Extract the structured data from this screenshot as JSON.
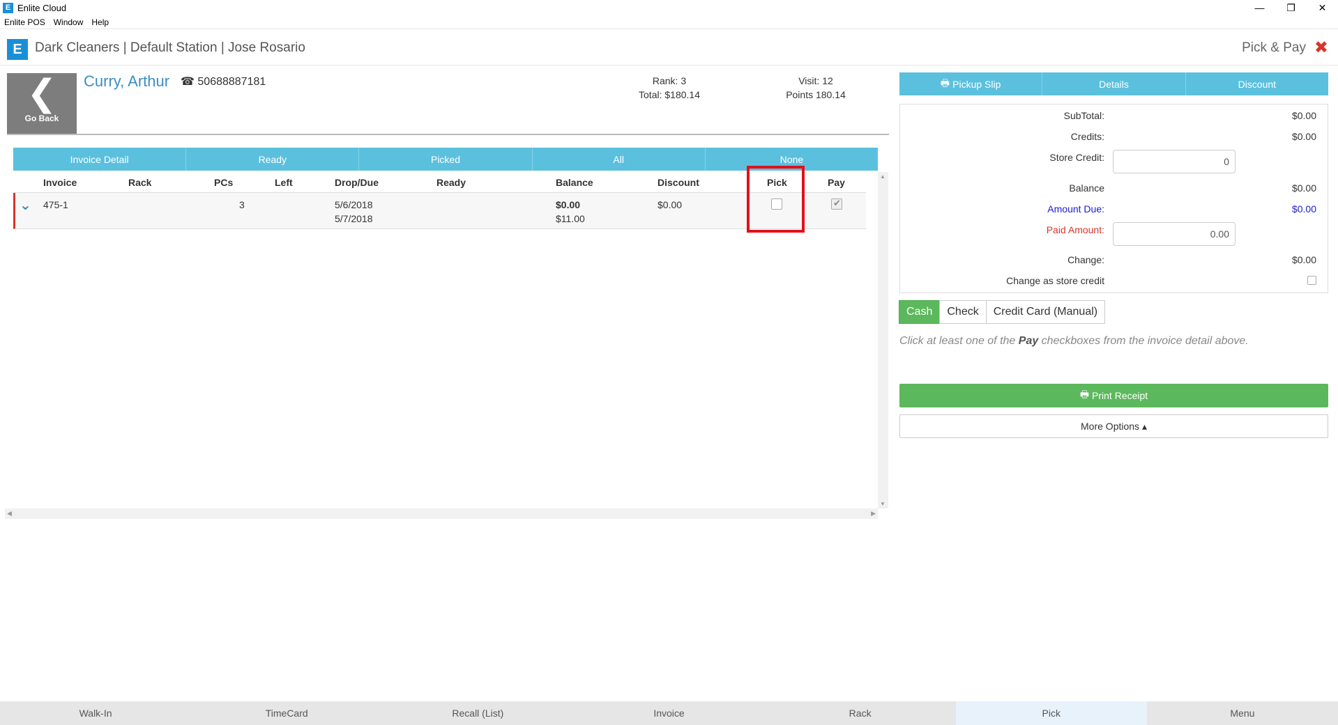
{
  "window": {
    "title": "Enlite Cloud",
    "app_icon": "E",
    "minimize": "—",
    "restore": "❐",
    "close": "✕"
  },
  "menu": [
    "Enlite POS",
    "Window",
    "Help"
  ],
  "header": {
    "logo": "E",
    "title": "Dark Cleaners | Default Station | Jose Rosario",
    "mode": "Pick & Pay",
    "close": "✖"
  },
  "customer": {
    "go_back_icon": "❮",
    "go_back": "Go Back",
    "name": "Curry, Arthur",
    "phone_icon": "☎",
    "phone": "50688887181",
    "rank": "Rank: 3",
    "total": "Total: $180.14",
    "visit": "Visit: 12",
    "points": "Points 180.14"
  },
  "filters": [
    "Invoice Detail",
    "Ready",
    "Picked",
    "All",
    "None"
  ],
  "table": {
    "columns": [
      "Invoice",
      "Rack",
      "PCs",
      "Left",
      "Drop/Due",
      "Ready",
      "Balance",
      "Discount",
      "Pick",
      "Pay"
    ],
    "rows": [
      {
        "expand_icon": "⌄",
        "invoice": "475-1",
        "rack": "",
        "pcs": "3",
        "left": "",
        "drop": "5/6/2018",
        "due": "5/7/2018",
        "ready": "",
        "balance": "$0.00",
        "balance_total": "$11.00",
        "discount": "$0.00",
        "pick": false,
        "pay": true
      }
    ]
  },
  "right_tabs": [
    "Pickup Slip",
    "Details",
    "Discount"
  ],
  "right_tab_icons": {
    "pickup_slip": "🖶"
  },
  "summary": {
    "subtotal_label": "SubTotal:",
    "subtotal": "$0.00",
    "credits_label": "Credits:",
    "credits": "$0.00",
    "store_credit_label": "Store Credit:",
    "store_credit": "0",
    "balance_label": "Balance",
    "balance": "$0.00",
    "amount_due_label": "Amount Due:",
    "amount_due": "$0.00",
    "paid_amount_label": "Paid Amount:",
    "paid_amount": "0.00",
    "change_label": "Change:",
    "change": "$0.00",
    "change_store_credit_label": "Change as store credit"
  },
  "payment_types": [
    "Cash",
    "Check",
    "Credit Card (Manual)"
  ],
  "hint": {
    "before": "Click at least one of the ",
    "bold": "Pay",
    "after": " checkboxes from the invoice detail above."
  },
  "print_receipt": "Print Receipt",
  "more_options": "More Options ▴",
  "bottom_nav": [
    "Walk-In",
    "TimeCard",
    "Recall (List)",
    "Invoice",
    "Rack",
    "Pick",
    "Menu"
  ],
  "colors": {
    "accent": "#5bc0de",
    "brand": "#1a8fd8",
    "success": "#5cb85c",
    "danger": "#d9342b"
  }
}
